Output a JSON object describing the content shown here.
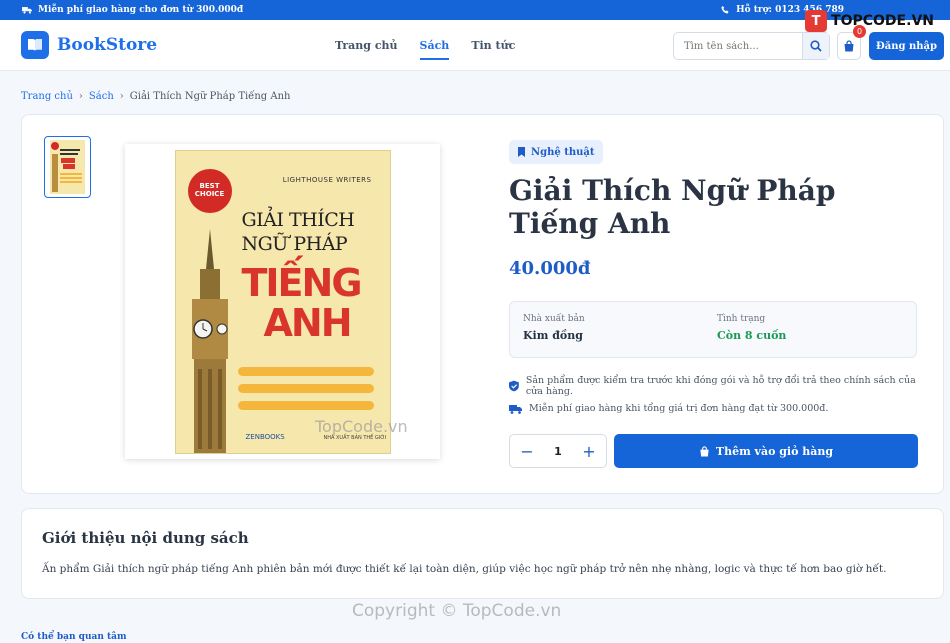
{
  "topbar": {
    "promo": "Miễn phí giao hàng cho đơn từ 300.000đ",
    "support": "Hỗ trợ: 0123 456 789"
  },
  "header": {
    "brand": "BookStore",
    "nav": [
      {
        "label": "Trang chủ",
        "active": false
      },
      {
        "label": "Sách",
        "active": true
      },
      {
        "label": "Tin tức",
        "active": false
      }
    ],
    "search_placeholder": "Tìm tên sách...",
    "cart_count": "0",
    "login_label": "Đăng nhập"
  },
  "breadcrumb": {
    "home": "Trang chủ",
    "books": "Sách",
    "current": "Giải Thích Ngữ Pháp Tiếng Anh"
  },
  "cover": {
    "publisher": "LIGHTHOUSE WRITERS",
    "badge_line1": "BEST",
    "badge_line2": "CHOICE",
    "title_line1": "GIẢI THÍCH",
    "title_line2": "NGỮ PHÁP",
    "title_line3": "TIẾNG",
    "title_line4": "ANH",
    "imprint": "ZENBOOKS",
    "nxb": "NHÀ XUẤT BẢN THẾ GIỚI"
  },
  "product": {
    "category": "Nghệ thuật",
    "title": "Giải Thích Ngữ Pháp Tiếng Anh",
    "price": "40.000đ",
    "publisher_label": "Nhà xuất bản",
    "publisher_value": "Kim đồng",
    "status_label": "Tình trạng",
    "status_value": "Còn 8 cuốn",
    "note_quality": "Sản phẩm được kiểm tra trước khi đóng gói và hỗ trợ đổi trả theo chính sách của cửa hàng.",
    "note_shipping": "Miễn phí giao hàng khi tổng giá trị đơn hàng đạt từ 300.000đ.",
    "quantity": "1",
    "add_to_cart": "Thêm vào giỏ hàng"
  },
  "description": {
    "heading": "Giới thiệu nội dung sách",
    "body": "Ấn phẩm Giải thích ngữ pháp tiếng Anh phiên bản mới được thiết kế lại toàn diện, giúp việc học ngữ pháp trở nên nhẹ nhàng, logic và thực tế hơn bao giờ hết."
  },
  "related": {
    "heading": "Có thể bạn quan tâm"
  },
  "watermarks": {
    "logo": "TOPCODE.VN",
    "center": "TopCode.vn",
    "bottom": "Copyright © TopCode.vn"
  },
  "colors": {
    "primary": "#1565d8",
    "accent_text": "#1e5cc8",
    "stock_green": "#1a9a54",
    "badge_red": "#e53935"
  }
}
